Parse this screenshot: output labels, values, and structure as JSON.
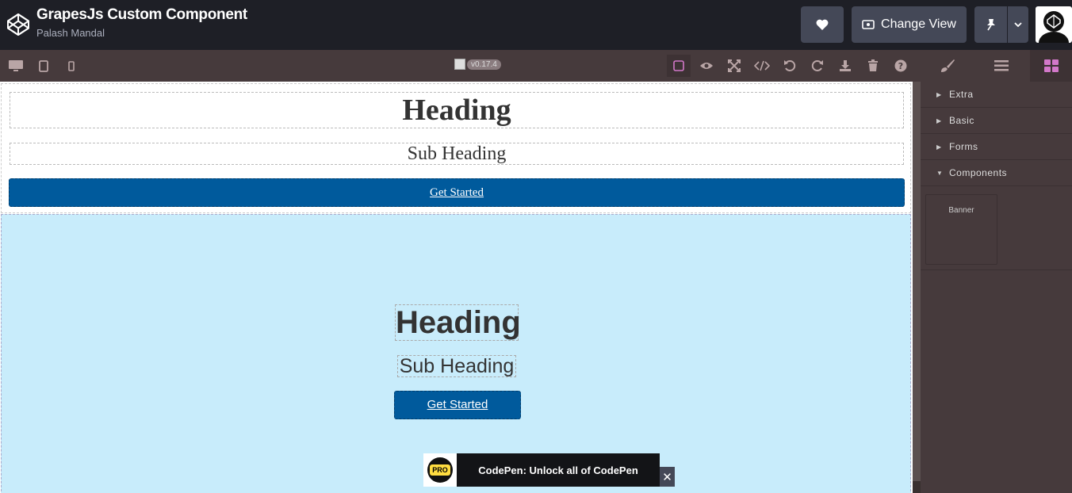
{
  "header": {
    "title": "GrapesJs Custom Component",
    "author": "Palash Mandal",
    "change_view_label": "Change View"
  },
  "editor": {
    "version": "v0.17.4",
    "categories": [
      {
        "label": "Extra",
        "open": false
      },
      {
        "label": "Basic",
        "open": false
      },
      {
        "label": "Forms",
        "open": false
      },
      {
        "label": "Components",
        "open": true
      }
    ],
    "blocks": [
      "Banner"
    ]
  },
  "canvas": {
    "section1": {
      "heading": "Heading",
      "subheading": "Sub Heading",
      "button": "Get Started"
    },
    "section2": {
      "heading": "Heading",
      "subheading": "Sub Heading",
      "button": "Get Started"
    }
  },
  "promo": {
    "badge": "PRO",
    "text": "CodePen: Unlock all of CodePen",
    "close": "✕"
  },
  "colors": {
    "accent": "#d278c9",
    "button": "#005a9c",
    "section_bg": "#c8ecfb",
    "panel_bg": "#463a3c"
  }
}
